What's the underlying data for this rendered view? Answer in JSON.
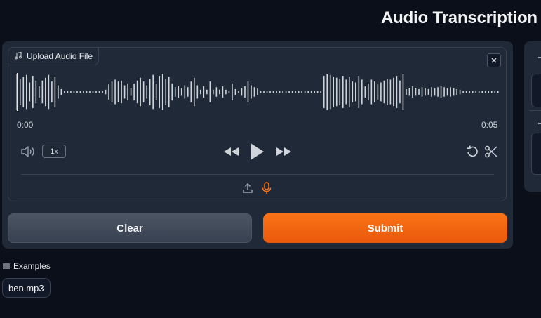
{
  "header": {
    "title": "Audio Transcription a"
  },
  "audio_input": {
    "label": "Upload Audio File",
    "time_start": "0:00",
    "time_end": "0:05",
    "playback_speed": "1x",
    "waveform_amplitudes": [
      0.95,
      0.7,
      0.8,
      0.9,
      0.5,
      0.85,
      0.6,
      0.3,
      0.6,
      0.75,
      0.9,
      0.55,
      0.8,
      0.35,
      0.15,
      0.05,
      0.05,
      0.05,
      0.05,
      0.05,
      0.05,
      0.05,
      0.05,
      0.05,
      0.05,
      0.05,
      0.05,
      0.05,
      0.12,
      0.4,
      0.55,
      0.65,
      0.55,
      0.6,
      0.35,
      0.45,
      0.2,
      0.45,
      0.6,
      0.75,
      0.55,
      0.35,
      0.7,
      0.9,
      0.45,
      0.85,
      0.95,
      0.7,
      0.8,
      0.45,
      0.25,
      0.3,
      0.2,
      0.35,
      0.25,
      0.55,
      0.75,
      0.35,
      0.12,
      0.3,
      0.12,
      0.55,
      0.12,
      0.25,
      0.12,
      0.3,
      0.12,
      0.05,
      0.45,
      0.15,
      0.05,
      0.2,
      0.3,
      0.55,
      0.35,
      0.25,
      0.18,
      0.05,
      0.05,
      0.05,
      0.05,
      0.05,
      0.05,
      0.05,
      0.05,
      0.05,
      0.05,
      0.05,
      0.05,
      0.05,
      0.05,
      0.05,
      0.05,
      0.05,
      0.05,
      0.05,
      0.05,
      0.85,
      0.95,
      0.9,
      0.8,
      0.75,
      0.7,
      0.85,
      0.65,
      0.8,
      0.55,
      0.5,
      0.85,
      0.65,
      0.3,
      0.45,
      0.65,
      0.55,
      0.4,
      0.5,
      0.6,
      0.7,
      0.65,
      0.75,
      0.85,
      0.6,
      0.95,
      0.15,
      0.2,
      0.3,
      0.2,
      0.15,
      0.25,
      0.2,
      0.15,
      0.25,
      0.2,
      0.25,
      0.3,
      0.25,
      0.2,
      0.25,
      0.2,
      0.15,
      0.12,
      0.05,
      0.05,
      0.05,
      0.05,
      0.05,
      0.05,
      0.05,
      0.05,
      0.05,
      0.05,
      0.05,
      0.05
    ]
  },
  "actions": {
    "clear_label": "Clear",
    "submit_label": "Submit"
  },
  "examples": {
    "label": "Examples",
    "items": [
      "ben.mp3"
    ]
  },
  "colors": {
    "accent": "#f97316",
    "waveform": "#d1d5db"
  },
  "icons": {
    "upload_label": "music-note-icon",
    "close": "close-icon",
    "volume": "volume-icon",
    "rewind": "rewind-icon",
    "play": "play-icon",
    "forward": "fast-forward-icon",
    "undo": "undo-icon",
    "trim": "scissors-icon",
    "upload": "upload-icon",
    "record": "microphone-icon",
    "examples": "list-icon"
  }
}
